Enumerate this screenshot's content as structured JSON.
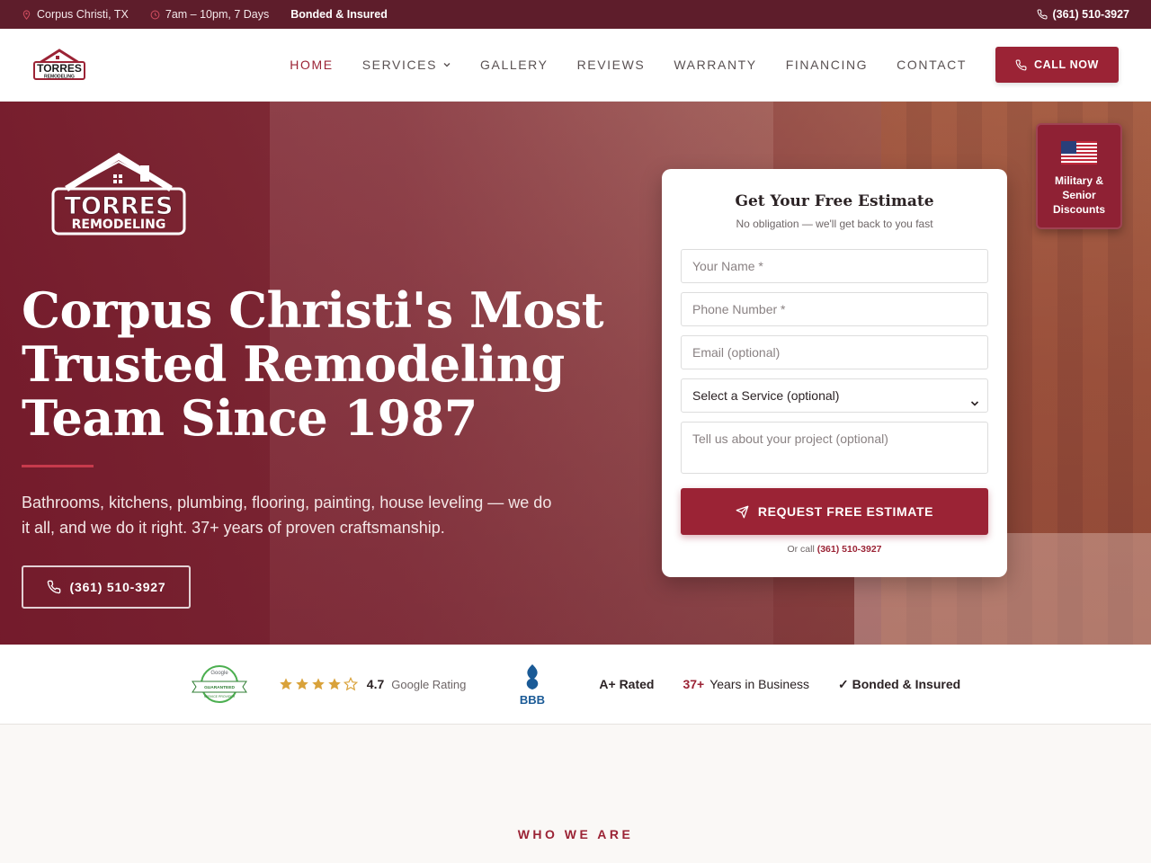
{
  "topbar": {
    "location": "Corpus Christi, TX",
    "hours": "7am – 10pm, 7 Days",
    "bonded": "Bonded & Insured",
    "phone": "(361) 510-3927"
  },
  "brand": {
    "logo_line1": "TORRES",
    "logo_line2": "REMODELING"
  },
  "nav": {
    "items": [
      {
        "label": "HOME",
        "active": true
      },
      {
        "label": "SERVICES",
        "dropdown": true
      },
      {
        "label": "GALLERY"
      },
      {
        "label": "REVIEWS"
      },
      {
        "label": "WARRANTY"
      },
      {
        "label": "FINANCING"
      },
      {
        "label": "CONTACT"
      }
    ],
    "call_label": "CALL NOW"
  },
  "hero": {
    "title_line1": "Corpus Christi's Most",
    "title_line2": "Trusted Remodeling",
    "title_line3": "Team Since 1987",
    "subtitle": "Bathrooms, kitchens, plumbing, flooring, painting, house leveling — we do it all, and we do it right. 37+ years of proven craftsmanship.",
    "phone": "(361) 510-3927"
  },
  "badge": {
    "line1": "Military &",
    "line2": "Senior",
    "line3": "Discounts"
  },
  "form": {
    "title": "Get Your Free Estimate",
    "subtitle": "No obligation — we'll get back to you fast",
    "name_placeholder": "Your Name *",
    "phone_placeholder": "Phone Number *",
    "email_placeholder": "Email (optional)",
    "service_selected": "Select a Service (optional)",
    "message_placeholder": "Tell us about your project (optional)",
    "submit_label": "REQUEST FREE ESTIMATE",
    "or_call_prefix": "Or call",
    "or_call_phone": "(361) 510-3927"
  },
  "trust": {
    "google_seal_top": "Google",
    "google_seal_mid": "GUARANTEED",
    "google_seal_bottom": "SERVICE PROVIDER",
    "stars": 4,
    "rating": "4.7",
    "rating_label": "Google Rating",
    "bbb_label": "BBB",
    "aplus": "A+ Rated",
    "years_num": "37+",
    "years_label": "Years in Business",
    "bonded": "✓ Bonded & Insured"
  },
  "section": {
    "eyebrow": "WHO WE ARE"
  },
  "colors": {
    "primary": "#9b2335",
    "topbar": "#5e1d2b",
    "star": "#d9a23a"
  }
}
